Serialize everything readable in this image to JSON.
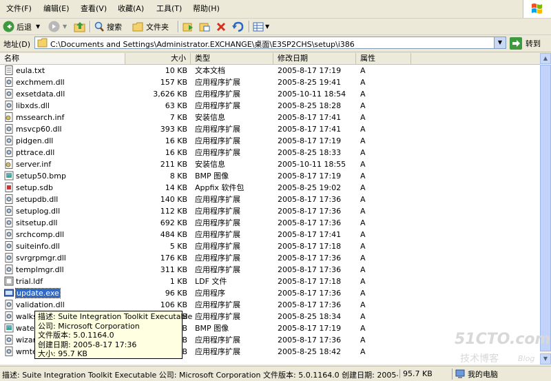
{
  "menu": [
    "文件(F)",
    "编辑(E)",
    "查看(V)",
    "收藏(A)",
    "工具(T)",
    "帮助(H)"
  ],
  "toolbar": {
    "back_label": "后退",
    "search_label": "搜索",
    "folders_label": "文件夹"
  },
  "address": {
    "label": "地址(D)",
    "path": "C:\\Documents and Settings\\Administrator.EXCHANGE\\桌面\\E3SP2CHS\\setup\\i386",
    "go_label": "转到"
  },
  "columns": [
    "名称",
    "大小",
    "类型",
    "修改日期",
    "属性"
  ],
  "files": [
    {
      "name": "eula.txt",
      "size": "10 KB",
      "type": "文本文档",
      "date": "2005-8-17 17:19",
      "attr": "A",
      "icon": "txt"
    },
    {
      "name": "exchmem.dll",
      "size": "157 KB",
      "type": "应用程序扩展",
      "date": "2005-8-25 19:41",
      "attr": "A",
      "icon": "dll"
    },
    {
      "name": "exsetdata.dll",
      "size": "3,626 KB",
      "type": "应用程序扩展",
      "date": "2005-10-11 18:54",
      "attr": "A",
      "icon": "dll"
    },
    {
      "name": "libxds.dll",
      "size": "63 KB",
      "type": "应用程序扩展",
      "date": "2005-8-25 18:28",
      "attr": "A",
      "icon": "dll"
    },
    {
      "name": "mssearch.inf",
      "size": "7 KB",
      "type": "安装信息",
      "date": "2005-8-17 17:41",
      "attr": "A",
      "icon": "inf"
    },
    {
      "name": "msvcp60.dll",
      "size": "393 KB",
      "type": "应用程序扩展",
      "date": "2005-8-17 17:41",
      "attr": "A",
      "icon": "dll"
    },
    {
      "name": "pidgen.dll",
      "size": "16 KB",
      "type": "应用程序扩展",
      "date": "2005-8-17 17:19",
      "attr": "A",
      "icon": "dll"
    },
    {
      "name": "pttrace.dll",
      "size": "16 KB",
      "type": "应用程序扩展",
      "date": "2005-8-25 18:33",
      "attr": "A",
      "icon": "dll"
    },
    {
      "name": "server.inf",
      "size": "211 KB",
      "type": "安装信息",
      "date": "2005-10-11 18:55",
      "attr": "A",
      "icon": "inf"
    },
    {
      "name": "setup50.bmp",
      "size": "8 KB",
      "type": "BMP 图像",
      "date": "2005-8-17 17:19",
      "attr": "A",
      "icon": "bmp"
    },
    {
      "name": "setup.sdb",
      "size": "14 KB",
      "type": "Appfix 软件包",
      "date": "2005-8-25 19:02",
      "attr": "A",
      "icon": "sdb"
    },
    {
      "name": "setupdb.dll",
      "size": "140 KB",
      "type": "应用程序扩展",
      "date": "2005-8-17 17:36",
      "attr": "A",
      "icon": "dll"
    },
    {
      "name": "setuplog.dll",
      "size": "112 KB",
      "type": "应用程序扩展",
      "date": "2005-8-17 17:36",
      "attr": "A",
      "icon": "dll"
    },
    {
      "name": "sitsetup.dll",
      "size": "692 KB",
      "type": "应用程序扩展",
      "date": "2005-8-17 17:36",
      "attr": "A",
      "icon": "dll"
    },
    {
      "name": "srchcomp.dll",
      "size": "484 KB",
      "type": "应用程序扩展",
      "date": "2005-8-17 17:41",
      "attr": "A",
      "icon": "dll"
    },
    {
      "name": "suiteinfo.dll",
      "size": "5 KB",
      "type": "应用程序扩展",
      "date": "2005-8-17 17:18",
      "attr": "A",
      "icon": "dll"
    },
    {
      "name": "svrgrpmgr.dll",
      "size": "176 KB",
      "type": "应用程序扩展",
      "date": "2005-8-17 17:36",
      "attr": "A",
      "icon": "dll"
    },
    {
      "name": "templmgr.dll",
      "size": "311 KB",
      "type": "应用程序扩展",
      "date": "2005-8-17 17:36",
      "attr": "A",
      "icon": "dll"
    },
    {
      "name": "trial.ldf",
      "size": "1 KB",
      "type": "LDF 文件",
      "date": "2005-8-17 17:18",
      "attr": "A",
      "icon": "ldf"
    },
    {
      "name": "update.exe",
      "size": "96 KB",
      "type": "应用程序",
      "date": "2005-8-17 17:36",
      "attr": "A",
      "icon": "exe",
      "selected": true
    },
    {
      "name": "validation.dll",
      "size": "106 KB",
      "type": "应用程序扩展",
      "date": "2005-8-17 17:36",
      "attr": "A",
      "icon": "dll"
    },
    {
      "name": "walks",
      "size": "B",
      "type": "应用程序扩展",
      "date": "2005-8-25 18:34",
      "attr": "A",
      "icon": "dll"
    },
    {
      "name": "water",
      "size": "B",
      "type": "BMP 图像",
      "date": "2005-8-17 17:19",
      "attr": "A",
      "icon": "bmp"
    },
    {
      "name": "wizar",
      "size": "B",
      "type": "应用程序扩展",
      "date": "2005-8-17 17:36",
      "attr": "A",
      "icon": "dll"
    },
    {
      "name": "wmte",
      "size": "B",
      "type": "应用程序扩展",
      "date": "2005-8-25 18:42",
      "attr": "A",
      "icon": "dll"
    }
  ],
  "tooltip": {
    "description": "描述: Suite Integration Toolkit Executable",
    "company": "公司: Microsoft Corporation",
    "version": "文件版本: 5.0.1164.0",
    "created": "创建日期: 2005-8-17 17:36",
    "size": "大小: 95.7 KB"
  },
  "status": {
    "description": "描述: Suite Integration Toolkit Executable 公司: Microsoft Corporation 文件版本: 5.0.1164.0 创建日期: 2005-8-17 17:36",
    "size": "95.7 KB",
    "zone": "我的电脑"
  },
  "watermark": {
    "site": "51CTO.com",
    "sub": "技术博客",
    "blog": "Blog"
  },
  "colors": {
    "selection": "#316ac5",
    "tooltip_bg": "#ffffe1",
    "xp_face": "#ece9d8"
  }
}
